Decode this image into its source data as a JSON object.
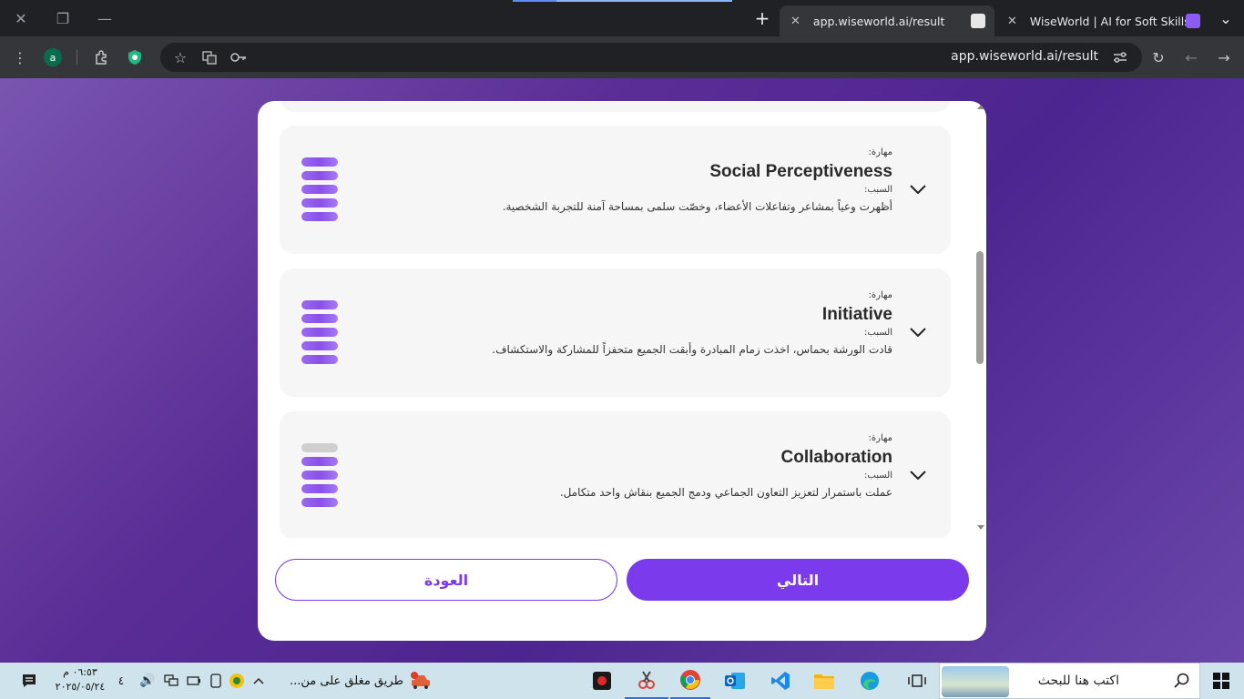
{
  "browser": {
    "tabs": [
      {
        "title": "app.wiseworld.ai/result",
        "active": true
      },
      {
        "title": "WiseWorld | AI for Soft Skills Gr",
        "active": false
      }
    ],
    "url": "app.wiseworld.ai/result",
    "profile_initial": "a"
  },
  "skills": [
    {
      "label": "مهارة:",
      "name": "Social Perceptiveness",
      "reason_label": "السبب:",
      "reason": "أظهرت وعياً بمشاعر وتفاعلات الأعضاء، وخصّت سلمى بمساحة آمنة للتجربة الشخصية.",
      "level": 5,
      "max_level": 5
    },
    {
      "label": "مهارة:",
      "name": "Initiative",
      "reason_label": "السبب:",
      "reason": "قادت الورشة بحماس، اخذت زمام المبادرة وأبقت الجميع متحفزاً للمشاركة والاستكشاف.",
      "level": 5,
      "max_level": 5
    },
    {
      "label": "مهارة:",
      "name": "Collaboration",
      "reason_label": "السبب:",
      "reason": "عملت باستمرار لتعزيز التعاون الجماعي ودمج الجميع بنقاش واحد متكامل.",
      "level": 4,
      "max_level": 5
    }
  ],
  "buttons": {
    "next": "التالي",
    "back": "العودة"
  },
  "taskbar": {
    "search_placeholder": "اكتب هنا للبحث",
    "notification": "طريق مغلق على من...",
    "time": "٠٦:٥٣ م",
    "date": "٢٠٢٥/٠٥/٢٤",
    "notification_count": "٤"
  },
  "colors": {
    "accent": "#7c3aed",
    "page_bg": "#5a2d96",
    "card_bg": "#f6f6f6"
  }
}
